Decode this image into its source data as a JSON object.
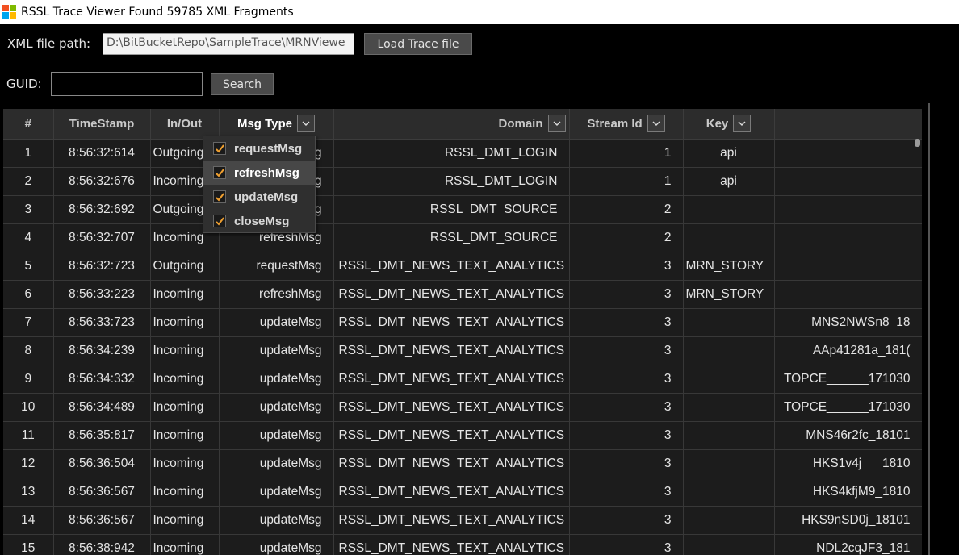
{
  "window": {
    "title": "RSSL Trace Viewer Found 59785 XML Fragments",
    "logo_colors": [
      "#f25022",
      "#7fba00",
      "#00a4ef",
      "#ffb900"
    ]
  },
  "toolbar": {
    "xml_path_label": "XML file path:",
    "xml_path_value": "D:\\BitBucketRepo\\SampleTrace\\MRNViewe",
    "load_button": "Load Trace file",
    "guid_label": "GUID:",
    "guid_value": "",
    "search_button": "Search"
  },
  "grid": {
    "columns": [
      "#",
      "TimeStamp",
      "In/Out",
      "Msg Type",
      "Domain",
      "Stream Id",
      "Key",
      ""
    ],
    "rows": [
      [
        "1",
        "8:56:32:614",
        "Outgoing",
        "requestMsg",
        "RSSL_DMT_LOGIN",
        "1",
        "api",
        ""
      ],
      [
        "2",
        "8:56:32:676",
        "Incoming",
        "refreshMsg",
        "RSSL_DMT_LOGIN",
        "1",
        "api",
        ""
      ],
      [
        "3",
        "8:56:32:692",
        "Outgoing",
        "requestMsg",
        "RSSL_DMT_SOURCE",
        "2",
        "",
        ""
      ],
      [
        "4",
        "8:56:32:707",
        "Incoming",
        "refreshMsg",
        "RSSL_DMT_SOURCE",
        "2",
        "",
        ""
      ],
      [
        "5",
        "8:56:32:723",
        "Outgoing",
        "requestMsg",
        "RSSL_DMT_NEWS_TEXT_ANALYTICS",
        "3",
        "MRN_STORY",
        ""
      ],
      [
        "6",
        "8:56:33:223",
        "Incoming",
        "refreshMsg",
        "RSSL_DMT_NEWS_TEXT_ANALYTICS",
        "3",
        "MRN_STORY",
        ""
      ],
      [
        "7",
        "8:56:33:723",
        "Incoming",
        "updateMsg",
        "RSSL_DMT_NEWS_TEXT_ANALYTICS",
        "3",
        "",
        "MNS2NWSn8_18"
      ],
      [
        "8",
        "8:56:34:239",
        "Incoming",
        "updateMsg",
        "RSSL_DMT_NEWS_TEXT_ANALYTICS",
        "3",
        "",
        "AAp41281a_181("
      ],
      [
        "9",
        "8:56:34:332",
        "Incoming",
        "updateMsg",
        "RSSL_DMT_NEWS_TEXT_ANALYTICS",
        "3",
        "",
        "TOPCE______171030"
      ],
      [
        "10",
        "8:56:34:489",
        "Incoming",
        "updateMsg",
        "RSSL_DMT_NEWS_TEXT_ANALYTICS",
        "3",
        "",
        "TOPCE______171030"
      ],
      [
        "11",
        "8:56:35:817",
        "Incoming",
        "updateMsg",
        "RSSL_DMT_NEWS_TEXT_ANALYTICS",
        "3",
        "",
        "MNS46r2fc_18101"
      ],
      [
        "12",
        "8:56:36:504",
        "Incoming",
        "updateMsg",
        "RSSL_DMT_NEWS_TEXT_ANALYTICS",
        "3",
        "",
        "HKS1v4j___1810"
      ],
      [
        "13",
        "8:56:36:567",
        "Incoming",
        "updateMsg",
        "RSSL_DMT_NEWS_TEXT_ANALYTICS",
        "3",
        "",
        "HKS4kfjM9_1810"
      ],
      [
        "14",
        "8:56:36:567",
        "Incoming",
        "updateMsg",
        "RSSL_DMT_NEWS_TEXT_ANALYTICS",
        "3",
        "",
        "HKS9nSD0j_18101"
      ],
      [
        "15",
        "8:56:38:942",
        "Incoming",
        "updateMsg",
        "RSSL_DMT_NEWS_TEXT_ANALYTICS",
        "3",
        "",
        "NDL2cqJF3_181"
      ]
    ]
  },
  "msgtype_filter": {
    "items": [
      {
        "label": "requestMsg",
        "checked": true
      },
      {
        "label": "refreshMsg",
        "checked": true
      },
      {
        "label": "updateMsg",
        "checked": true
      },
      {
        "label": "closeMsg",
        "checked": true
      }
    ],
    "check_color": "#f0a030"
  }
}
